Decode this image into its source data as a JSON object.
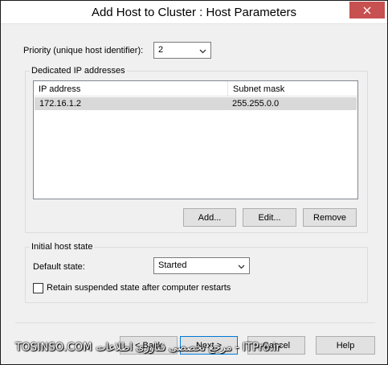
{
  "window": {
    "title": "Add Host to Cluster : Host Parameters"
  },
  "priority": {
    "label": "Priority (unique host identifier):",
    "value": "2"
  },
  "dedicated_ip": {
    "group_title": "Dedicated IP addresses",
    "columns": [
      "IP address",
      "Subnet mask"
    ],
    "rows": [
      {
        "ip": "172.16.1.2",
        "mask": "255.255.0.0"
      }
    ],
    "buttons": {
      "add": "Add...",
      "edit": "Edit...",
      "remove": "Remove"
    }
  },
  "initial_state": {
    "group_title": "Initial host state",
    "default_state_label": "Default state:",
    "default_state_value": "Started",
    "retain_label": "Retain suspended state after computer restarts",
    "retain_checked": false
  },
  "footer": {
    "back": "< Back",
    "next": "Next >",
    "cancel": "Cancel",
    "help": "Help"
  },
  "watermark": "TOSINSO.COM   مرجع تخصصی فناوری اطلاعات - ITPro.ir",
  "icons": {
    "close": "close-icon",
    "dropdown": "chevron-down-icon"
  },
  "colors": {
    "close_button": "#c75050",
    "selected_row": "#d9d9d9",
    "default_button_border": "#0078d7"
  }
}
